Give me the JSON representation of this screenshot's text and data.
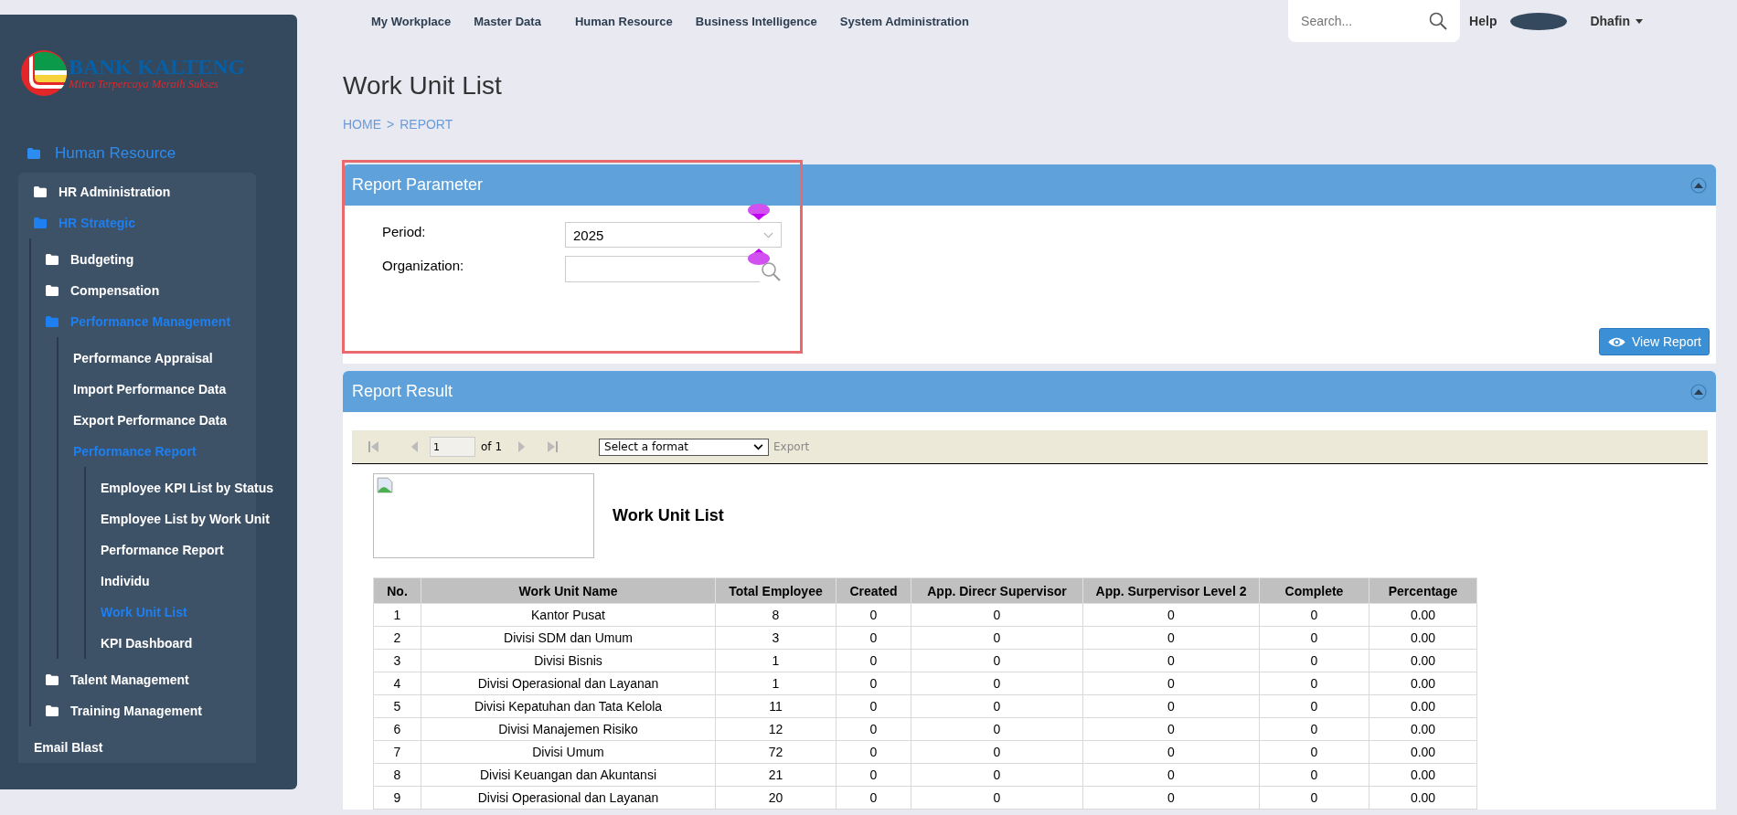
{
  "nav": {
    "menu": [
      "My Workplace",
      "Master Data",
      "Human Resource",
      "Business Intelligence",
      "System Administration"
    ],
    "search": {
      "placeholder": "Search..."
    },
    "help": "Help",
    "user": "Dhafin"
  },
  "logo": {
    "name": "BANK KALTENG",
    "tagline": "Mitra Terpercaya Meraih Sukses"
  },
  "sidebar": {
    "items": [
      {
        "kind": "folder",
        "label": "Human Resource",
        "expanded": true,
        "children": [
          {
            "kind": "folder",
            "label": "HR Administration",
            "expanded": false
          },
          {
            "kind": "folder",
            "label": "HR Strategic",
            "expanded": true,
            "children": [
              {
                "kind": "folder",
                "label": "Budgeting",
                "expanded": false
              },
              {
                "kind": "folder",
                "label": "Compensation",
                "expanded": false
              },
              {
                "kind": "folder",
                "label": "Performance Management",
                "expanded": true,
                "children": [
                  {
                    "kind": "page",
                    "label": "Performance Appraisal",
                    "selected": false
                  },
                  {
                    "kind": "page",
                    "label": "Import Performance Data",
                    "selected": false
                  },
                  {
                    "kind": "page",
                    "label": "Export Performance Data",
                    "selected": false
                  },
                  {
                    "kind": "page",
                    "label": "Performance Report",
                    "expanded": true,
                    "children": [
                      {
                        "kind": "page",
                        "label": "Employee KPI List by Status",
                        "selected": false
                      },
                      {
                        "kind": "page",
                        "label": "Employee List by Work Unit",
                        "selected": false
                      },
                      {
                        "kind": "page",
                        "label": "Performance Report",
                        "selected": false
                      },
                      {
                        "kind": "page",
                        "label": "Individu",
                        "selected": false
                      },
                      {
                        "kind": "page",
                        "label": "Work Unit List",
                        "selected": true
                      },
                      {
                        "kind": "page",
                        "label": "KPI Dashboard",
                        "selected": false
                      }
                    ]
                  }
                ]
              },
              {
                "kind": "folder",
                "label": "Talent Management",
                "expanded": false
              },
              {
                "kind": "folder",
                "label": "Training Management",
                "expanded": false
              }
            ]
          },
          {
            "kind": "page",
            "label": "Email Blast",
            "selected": false
          }
        ]
      }
    ]
  },
  "page": {
    "title": "Work Unit List",
    "breadcrumb": [
      "HOME",
      "REPORT"
    ],
    "separator": ">"
  },
  "parameter_panel": {
    "title": "Report Parameter",
    "fields": [
      {
        "kind": "select",
        "label": "Period:",
        "value": "2025"
      },
      {
        "kind": "lookup",
        "label": "Organization:"
      }
    ],
    "button": "View Report"
  },
  "result_panel": {
    "title": "Report Result",
    "toolbar": {
      "page": "1",
      "of": "of 1",
      "format": "Select a format",
      "export": "Export",
      "export_disabled": true
    },
    "report": {
      "title": "Work Unit List",
      "table": {
        "columns": [
          "No.",
          "Work Unit Name",
          "Total Employee",
          "Created",
          "App. Direcr Supervisor",
          "App. Surpervisor Level 2",
          "Complete",
          "Percentage"
        ],
        "rows": [
          [
            "1",
            "Kantor Pusat",
            "8",
            "0",
            "0",
            "0",
            "0",
            "0.00"
          ],
          [
            "2",
            "Divisi SDM dan Umum",
            "3",
            "0",
            "0",
            "0",
            "0",
            "0.00"
          ],
          [
            "3",
            "Divisi Bisnis",
            "1",
            "0",
            "0",
            "0",
            "0",
            "0.00"
          ],
          [
            "4",
            "Divisi Operasional dan Layanan",
            "1",
            "0",
            "0",
            "0",
            "0",
            "0.00"
          ],
          [
            "5",
            "Divisi Kepatuhan dan Tata Kelola",
            "11",
            "0",
            "0",
            "0",
            "0",
            "0.00"
          ],
          [
            "6",
            "Divisi Manajemen Risiko",
            "12",
            "0",
            "0",
            "0",
            "0",
            "0.00"
          ],
          [
            "7",
            "Divisi Umum",
            "72",
            "0",
            "0",
            "0",
            "0",
            "0.00"
          ],
          [
            "8",
            "Divisi Keuangan dan Akuntansi",
            "21",
            "0",
            "0",
            "0",
            "0",
            "0.00"
          ],
          [
            "9",
            "Divisi Operasional dan Layanan",
            "20",
            "0",
            "0",
            "0",
            "0",
            "0.00"
          ]
        ]
      }
    }
  }
}
